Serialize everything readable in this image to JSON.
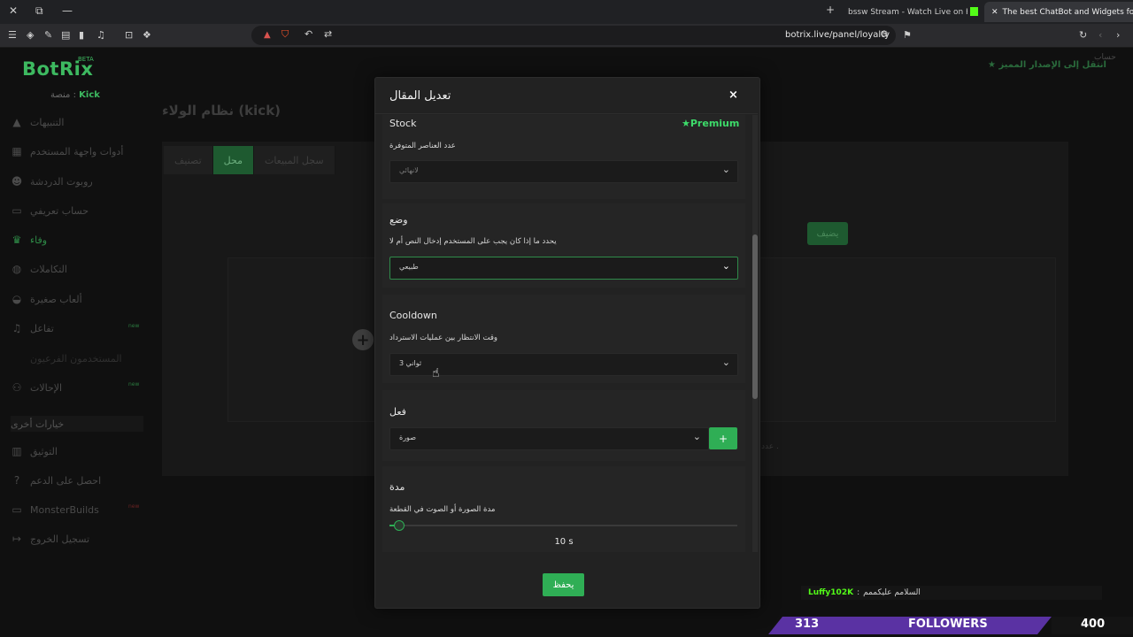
{
  "browser": {
    "tabs": [
      {
        "title": "bssw Stream - Watch Live on Kick"
      },
      {
        "title": "The best ChatBot and Widgets fo"
      }
    ],
    "url": "botrix.live/panel/loyalty",
    "window_icons": {
      "close": "✕",
      "restore": "⧉",
      "minimize": "—",
      "new_tab": "+"
    }
  },
  "app": {
    "logo": "BotRix",
    "beta": "BETA",
    "platform_prefix": "منصة :",
    "platform_value": "Kick",
    "promo": "انتقل إلى الإصدار المميز",
    "account": "حساب",
    "page_title": "نظام الولاء (kick)",
    "accent": "#2fae55"
  },
  "sidebar": {
    "items": [
      {
        "label": "التنبيهات",
        "icon": "warning-icon"
      },
      {
        "label": "أدوات واجهة المستخدم",
        "icon": "widgets-icon"
      },
      {
        "label": "روبوت الدردشة",
        "icon": "robot-icon"
      },
      {
        "label": "حساب تعريفي",
        "icon": "id-card-icon"
      },
      {
        "label": "وفاء",
        "icon": "trophy-icon"
      },
      {
        "label": "التكاملات",
        "icon": "integrations-icon"
      },
      {
        "label": "ألعاب صغيرة",
        "icon": "gamepad-icon"
      },
      {
        "label": "تفاعل",
        "icon": "music-icon",
        "badge": "new"
      },
      {
        "label": "المستخدمون الفرعيون",
        "icon": "users-icon"
      },
      {
        "label": "الإحالات",
        "icon": "referral-icon",
        "badge": "new"
      }
    ],
    "section_title": "خيارات أخرى",
    "other_items": [
      {
        "label": "التوثيق",
        "icon": "book-icon"
      },
      {
        "label": "احصل على الدعم",
        "icon": "help-icon"
      },
      {
        "label": "MonsterBuilds",
        "icon": "monitor-icon",
        "badge": "new"
      },
      {
        "label": "تسجيل الخروج",
        "icon": "logout-icon"
      }
    ]
  },
  "store_tabs": [
    "تصنيف",
    "محل",
    "سجل المبيعات"
  ],
  "background": {
    "button": "يضيف",
    "partial_text": "عدد ."
  },
  "modal": {
    "title": "تعديل المقال",
    "close": "×",
    "premium_label": "Premium",
    "fields": {
      "stock": {
        "label": "Stock",
        "hint": "عدد العناصر المتوفرة",
        "value": "لانهائي"
      },
      "mode": {
        "label": "وضع",
        "hint": "يحدد ما إذا كان يجب على المستخدم إدخال النص أم لا",
        "value": "طبيعي"
      },
      "cooldown": {
        "label": "Cooldown",
        "hint": "وقت الانتظار بين عمليات الاسترداد",
        "value": "3 ثواني"
      },
      "action": {
        "label": "فعل",
        "value": "صورة",
        "add": "+"
      },
      "duration": {
        "label": "مدة",
        "hint": "مدة الصورة أو الصوت في القطعة",
        "value": "10 s",
        "level": 0.03
      }
    },
    "save": "يحفظ"
  },
  "stream_overlay": {
    "chat_user": "Luffy102K",
    "chat_message": "السلامم عليكممم",
    "followers_count": "313",
    "followers_label": "FOLLOWERS",
    "goal": "400"
  }
}
